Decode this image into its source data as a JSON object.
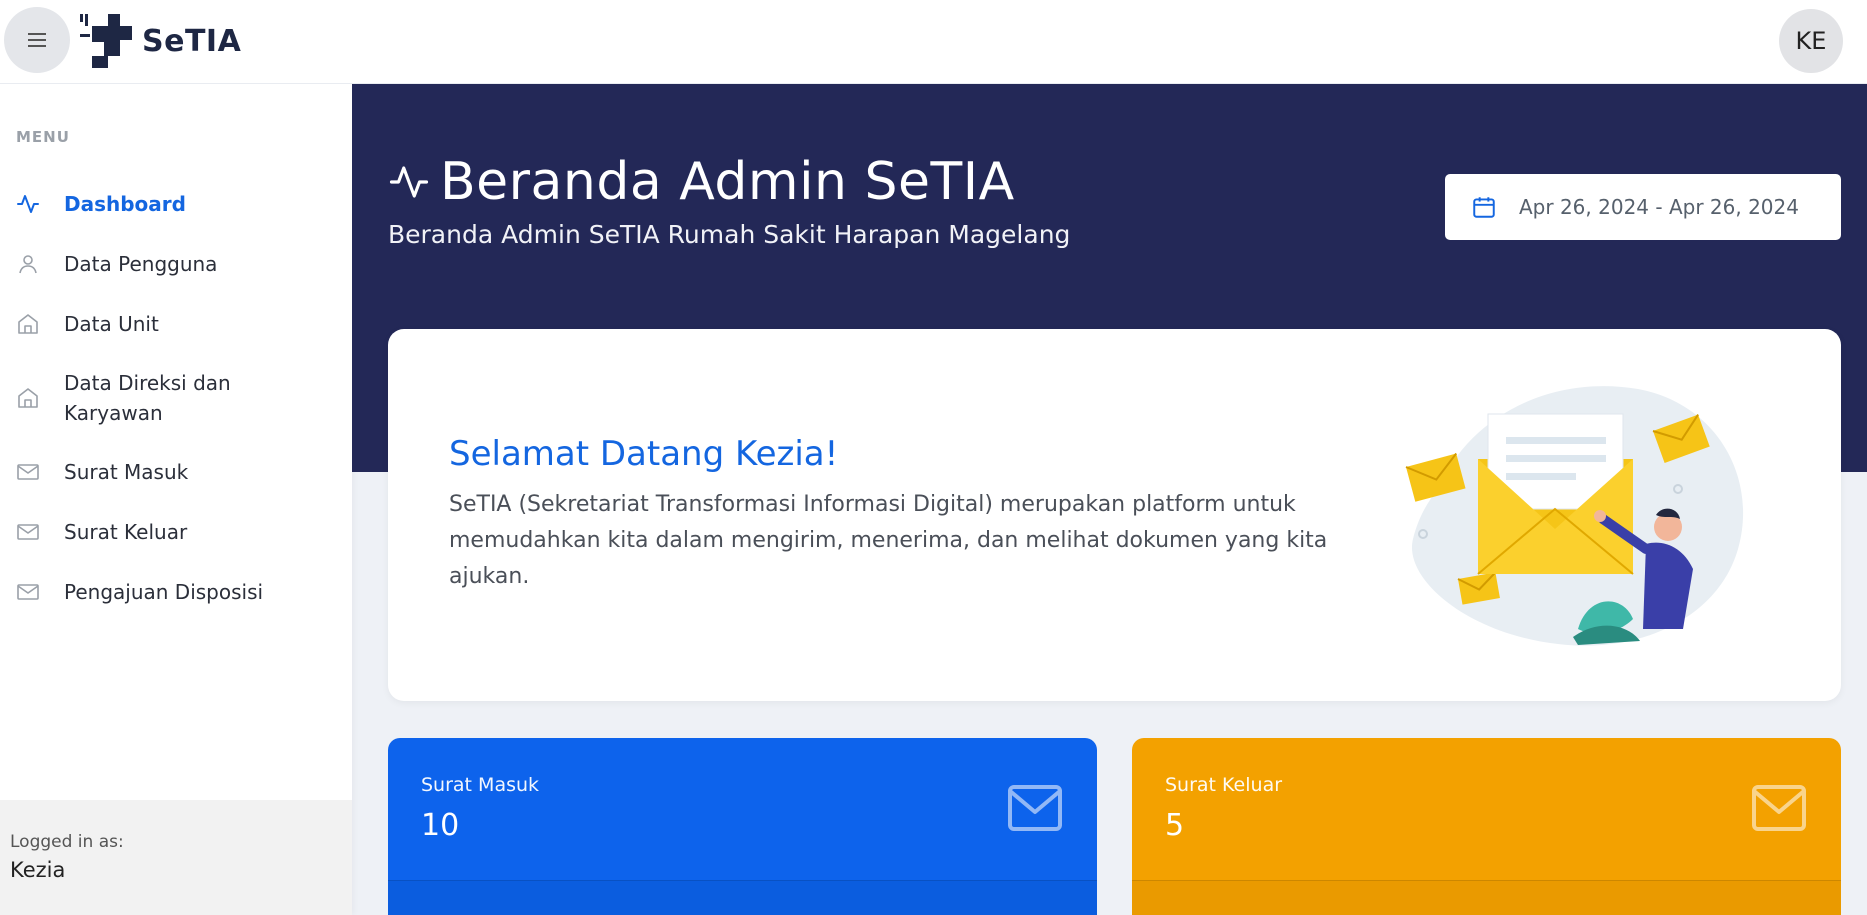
{
  "brand": {
    "name": "SeTIA"
  },
  "user": {
    "initials": "KE",
    "logged_in_label": "Logged in as:",
    "name": "Kezia"
  },
  "sidebar": {
    "menu_title": "MENU",
    "items": [
      {
        "label": "Dashboard",
        "icon": "activity-icon",
        "active": true
      },
      {
        "label": "Data Pengguna",
        "icon": "user-icon"
      },
      {
        "label": "Data Unit",
        "icon": "home-icon"
      },
      {
        "label": "Data Direksi dan Karyawan",
        "icon": "home-icon"
      },
      {
        "label": "Surat Masuk",
        "icon": "mail-icon"
      },
      {
        "label": "Surat Keluar",
        "icon": "mail-icon"
      },
      {
        "label": "Pengajuan Disposisi",
        "icon": "mail-icon"
      }
    ]
  },
  "header": {
    "title": "Beranda Admin SeTIA",
    "subtitle": "Beranda Admin SeTIA Rumah Sakit Harapan Magelang",
    "date_range": "Apr 26, 2024 - Apr 26, 2024"
  },
  "welcome": {
    "title": "Selamat Datang Kezia!",
    "body": "SeTIA (Sekretariat Transformasi Informasi Digital) merupakan platform untuk memudahkan kita dalam mengirim, menerima, dan melihat dokumen yang kita ajukan."
  },
  "stats": [
    {
      "label": "Surat Masuk",
      "value": "10",
      "color": "#0d63ec",
      "icon": "mail-icon"
    },
    {
      "label": "Surat Keluar",
      "value": "5",
      "color": "#f3a100",
      "icon": "mail-icon"
    }
  ],
  "colors": {
    "accent": "#1466e0",
    "hero": "#232857"
  }
}
